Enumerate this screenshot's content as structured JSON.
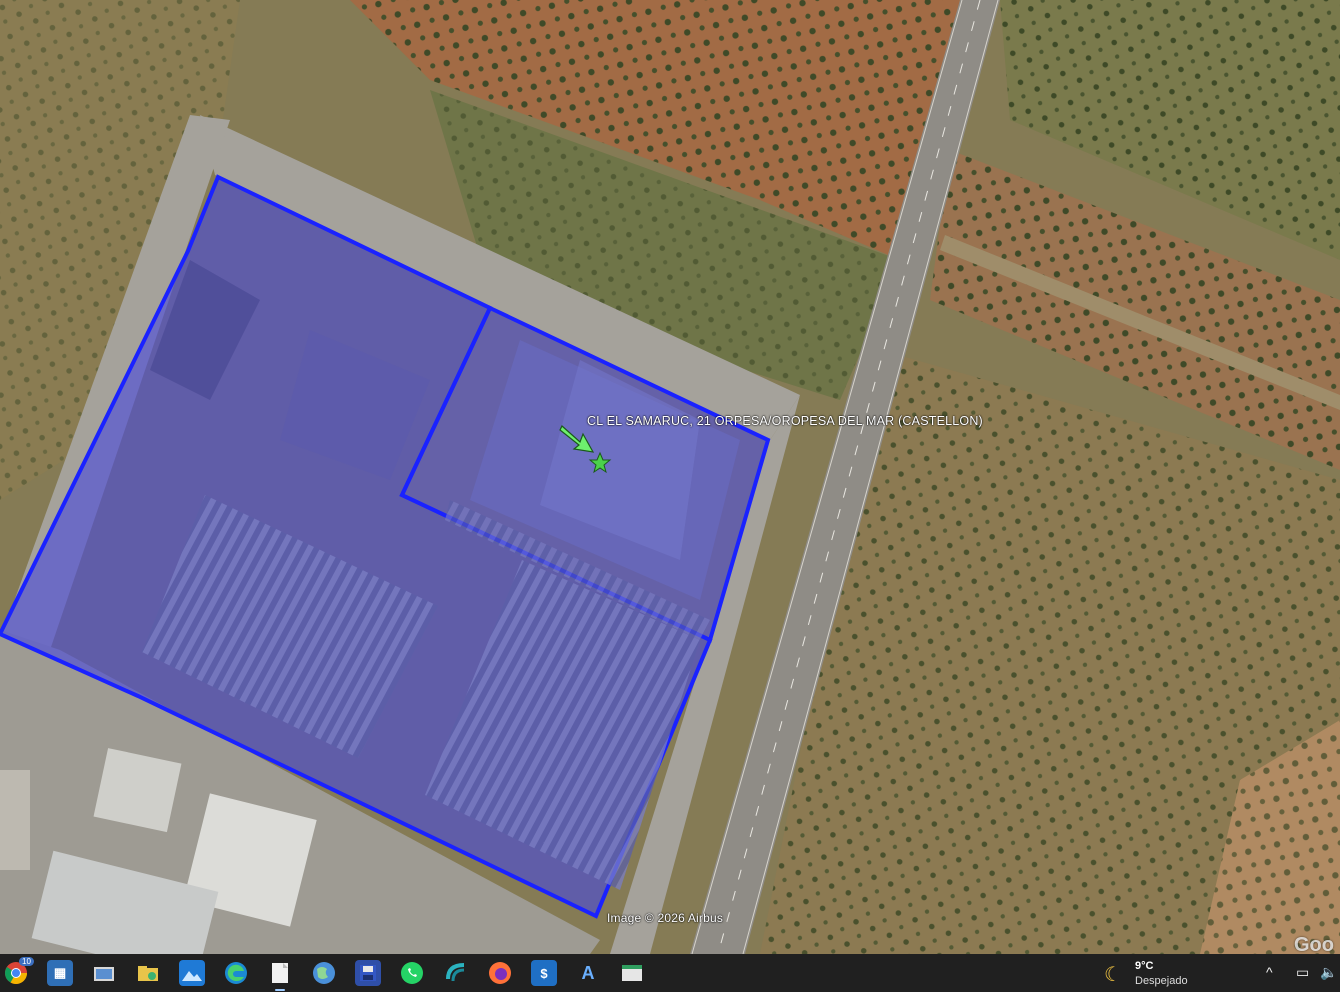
{
  "map": {
    "parcel_label": "CL EL SAMARUC, 21  ORPESA/OROPESA DEL MAR (CASTELLON)",
    "copyright": "Image © 2026 Airbus",
    "logo": "Goo",
    "parcel_outline_color": "#1a22ff",
    "parcel_fill_color": "#4a4adc",
    "placemark_color": "#4bd14b"
  },
  "taskbar": {
    "apps": [
      {
        "name": "chrome-icon",
        "badge": "10"
      },
      {
        "name": "image-viewer-icon"
      },
      {
        "name": "file-explorer-camera-icon"
      },
      {
        "name": "shared-folder-icon"
      },
      {
        "name": "photos-icon"
      },
      {
        "name": "edge-icon"
      },
      {
        "name": "document-icon"
      },
      {
        "name": "google-earth-icon"
      },
      {
        "name": "save-disk-icon"
      },
      {
        "name": "whatsapp-icon"
      },
      {
        "name": "sync-app-icon"
      },
      {
        "name": "firefox-icon"
      },
      {
        "name": "dollar-app-icon"
      },
      {
        "name": "autocad-icon"
      },
      {
        "name": "window-app-icon"
      }
    ],
    "weather": {
      "temperature": "9°C",
      "description": "Despejado"
    }
  }
}
